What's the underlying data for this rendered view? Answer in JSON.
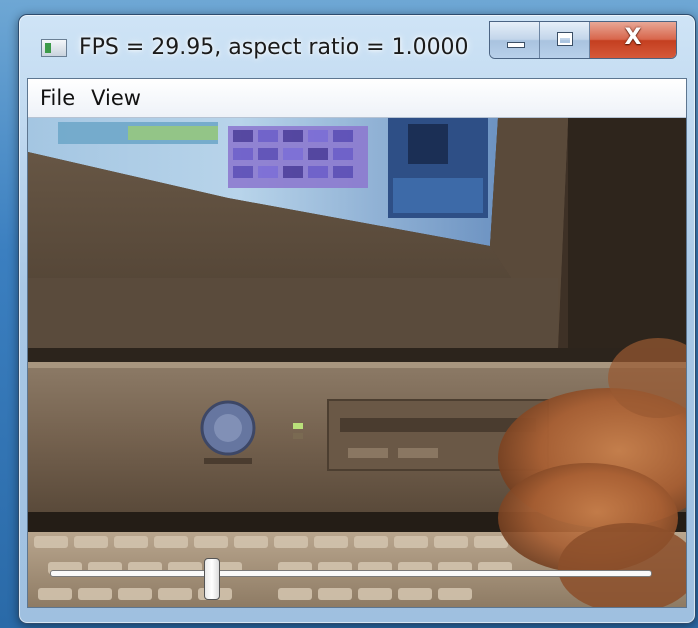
{
  "window": {
    "title": "FPS = 29.95, aspect ratio = 1.0000",
    "app_icon": "video-window-icon",
    "caption_buttons": {
      "minimize_icon": "minimize-icon",
      "maximize_icon": "maximize-icon",
      "close_label": "X"
    }
  },
  "menubar": {
    "items": [
      {
        "label": "File"
      },
      {
        "label": "View"
      }
    ]
  },
  "video": {
    "content": "webcam-frame",
    "position_fraction": 0.27
  },
  "colors": {
    "close_button": "#c8432a",
    "frame": "#a9c8e6",
    "video_background": "#3a2e22"
  }
}
